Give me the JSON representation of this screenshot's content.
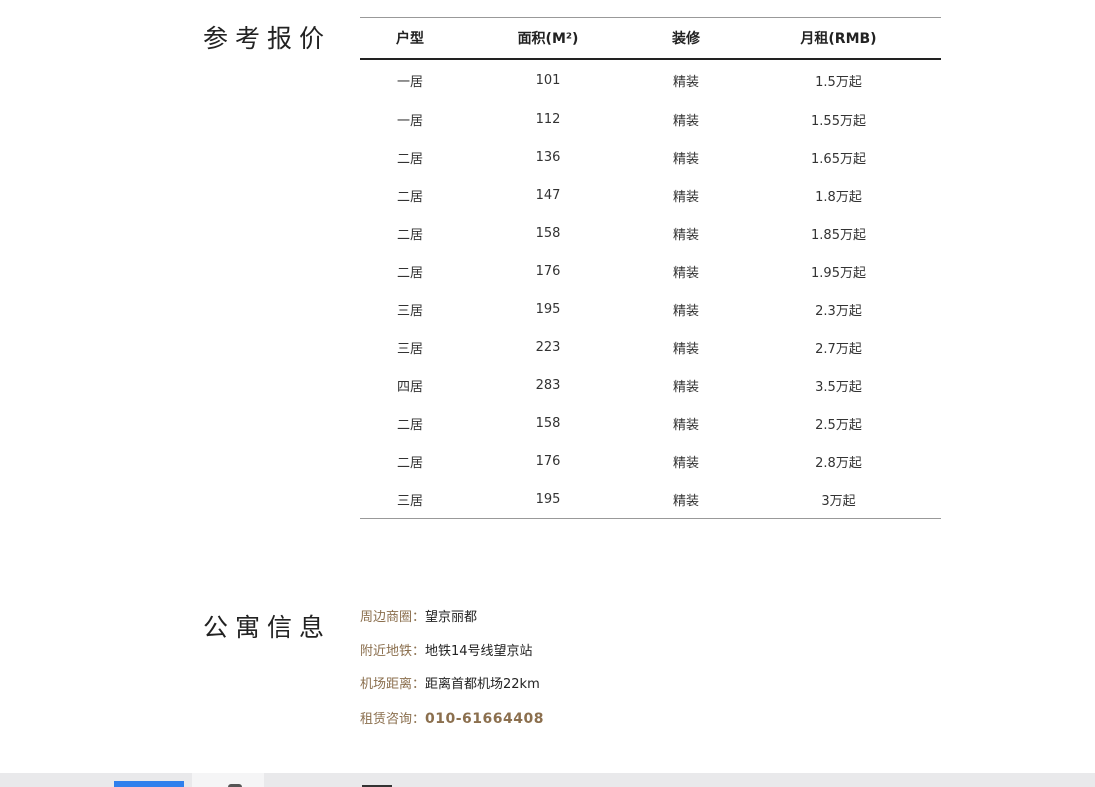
{
  "sections": {
    "price_title": "参考报价",
    "info_title": "公寓信息"
  },
  "price_table": {
    "headers": [
      "户型",
      "面积(M²)",
      "装修",
      "月租(RMB)"
    ],
    "rows": [
      [
        "一居",
        "101",
        "精装",
        "1.5万起"
      ],
      [
        "一居",
        "112",
        "精装",
        "1.55万起"
      ],
      [
        "二居",
        "136",
        "精装",
        "1.65万起"
      ],
      [
        "二居",
        "147",
        "精装",
        "1.8万起"
      ],
      [
        "二居",
        "158",
        "精装",
        "1.85万起"
      ],
      [
        "二居",
        "176",
        "精装",
        "1.95万起"
      ],
      [
        "三居",
        "195",
        "精装",
        "2.3万起"
      ],
      [
        "三居",
        "223",
        "精装",
        "2.7万起"
      ],
      [
        "四居",
        "283",
        "精装",
        "3.5万起"
      ],
      [
        "二居",
        "158",
        "精装",
        "2.5万起"
      ],
      [
        "二居",
        "176",
        "精装",
        "2.8万起"
      ],
      [
        "三居",
        "195",
        "精装",
        "3万起"
      ]
    ]
  },
  "apartment_info": {
    "items": [
      {
        "label": "周边商圈：",
        "value": "望京丽都"
      },
      {
        "label": "附近地铁：",
        "value": "地铁14号线望京站"
      },
      {
        "label": "机场距离：",
        "value": "距离首都机场22km"
      },
      {
        "label": "租赁咨询：",
        "value": "010-61664408"
      }
    ]
  },
  "colors": {
    "accent": "#8b6f4e",
    "text": "#222222",
    "bottom_tab_active": "#2f80ed"
  }
}
